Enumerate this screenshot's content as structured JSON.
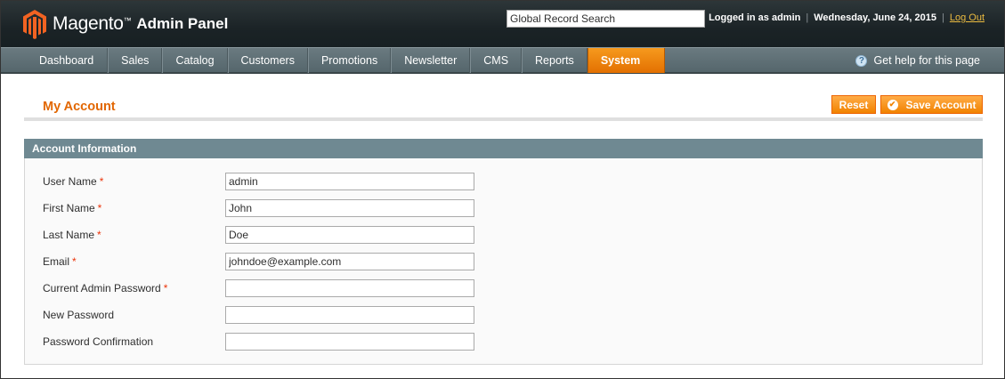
{
  "header": {
    "brand": "Magento",
    "brand_tm": "™",
    "brand_sub": "Admin Panel",
    "search_value": "Global Record Search",
    "logged_in": "Logged in as admin",
    "date": "Wednesday, June 24, 2015",
    "logout": "Log Out",
    "separator": "|"
  },
  "nav": {
    "items": [
      {
        "label": "Dashboard"
      },
      {
        "label": "Sales"
      },
      {
        "label": "Catalog"
      },
      {
        "label": "Customers"
      },
      {
        "label": "Promotions"
      },
      {
        "label": "Newsletter"
      },
      {
        "label": "CMS"
      },
      {
        "label": "Reports"
      },
      {
        "label": "System",
        "active": true
      }
    ],
    "help": "Get help for this page",
    "help_icon": "?"
  },
  "page": {
    "title": "My Account",
    "reset_label": "Reset",
    "save_label": "Save Account"
  },
  "section": {
    "title": "Account Information",
    "fields": [
      {
        "label": "User Name",
        "required": true,
        "value": "admin"
      },
      {
        "label": "First Name",
        "required": true,
        "value": "John"
      },
      {
        "label": "Last Name",
        "required": true,
        "value": "Doe"
      },
      {
        "label": "Email",
        "required": true,
        "value": "johndoe@example.com"
      },
      {
        "label": "Current Admin Password",
        "required": true,
        "value": ""
      },
      {
        "label": "New Password",
        "required": false,
        "value": ""
      },
      {
        "label": "Password Confirmation",
        "required": false,
        "value": ""
      }
    ],
    "required_mark": "*"
  },
  "colors": {
    "accent": "#e26703",
    "button": "#f18200",
    "nav_active": "#eb7d0f",
    "section_head": "#6f8992"
  }
}
